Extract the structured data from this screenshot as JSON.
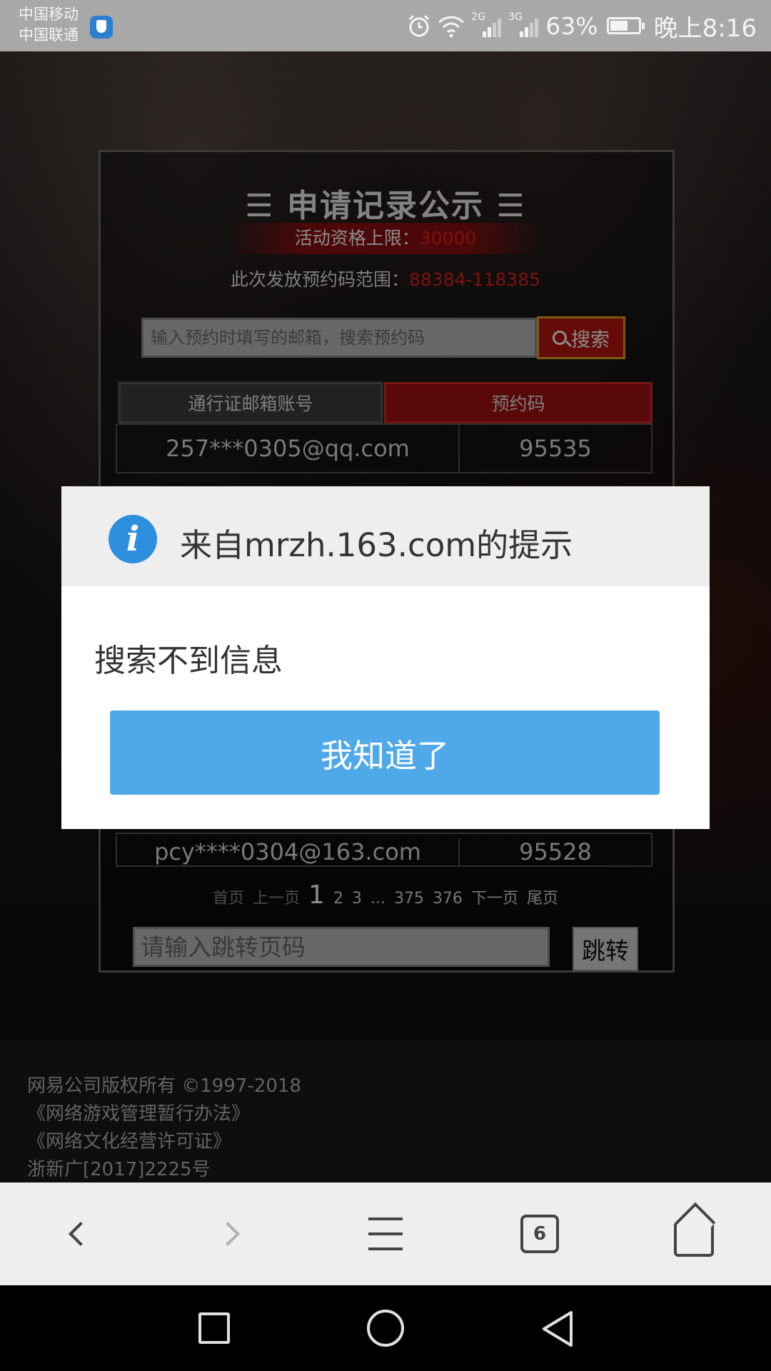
{
  "status_bar": {
    "carrier_1": "中国移动",
    "carrier_2": "中国联通",
    "network_1": "2G",
    "network_2": "3G",
    "battery": "63%",
    "time": "晚上8:16"
  },
  "page": {
    "title": "☰ 申请记录公示 ☰",
    "limit_label": "活动资格上限：",
    "limit_value": "30000",
    "range_label": "此次发放预约码范围：",
    "range_value": "88384-118385",
    "search": {
      "placeholder": "输入预约时填写的邮箱，搜索预约码",
      "button_label": "搜索"
    },
    "table": {
      "headers": [
        "通行证邮箱账号",
        "预约码"
      ],
      "rows": [
        {
          "email": "257***0305@qq.com",
          "code": "95535"
        },
        {
          "email": "pcy****0304@163.com",
          "code": "95528"
        }
      ]
    },
    "pagination": {
      "first": "首页",
      "prev": "上一页",
      "current": "1",
      "pages": [
        "2",
        "3",
        "...",
        "375",
        "376"
      ],
      "next": "下一页",
      "last": "尾页"
    },
    "jump": {
      "placeholder": "请输入跳转页码",
      "button_label": "跳转"
    }
  },
  "footer": {
    "lines": [
      "网易公司版权所有 ©1997-2018",
      "《网络游戏管理暂行办法》",
      "《网络文化经营许可证》",
      "浙新广[2017]2225号"
    ]
  },
  "dialog": {
    "icon": "info-icon",
    "title": "来自mrzh.163.com的提示",
    "message": "搜索不到信息",
    "button_label": "我知道了"
  },
  "browser_toolbar": {
    "tab_count": "6"
  },
  "colors": {
    "accent_red": "#e8201a",
    "dialog_button": "#4fa8e8",
    "info_icon": "#2d8fde"
  }
}
